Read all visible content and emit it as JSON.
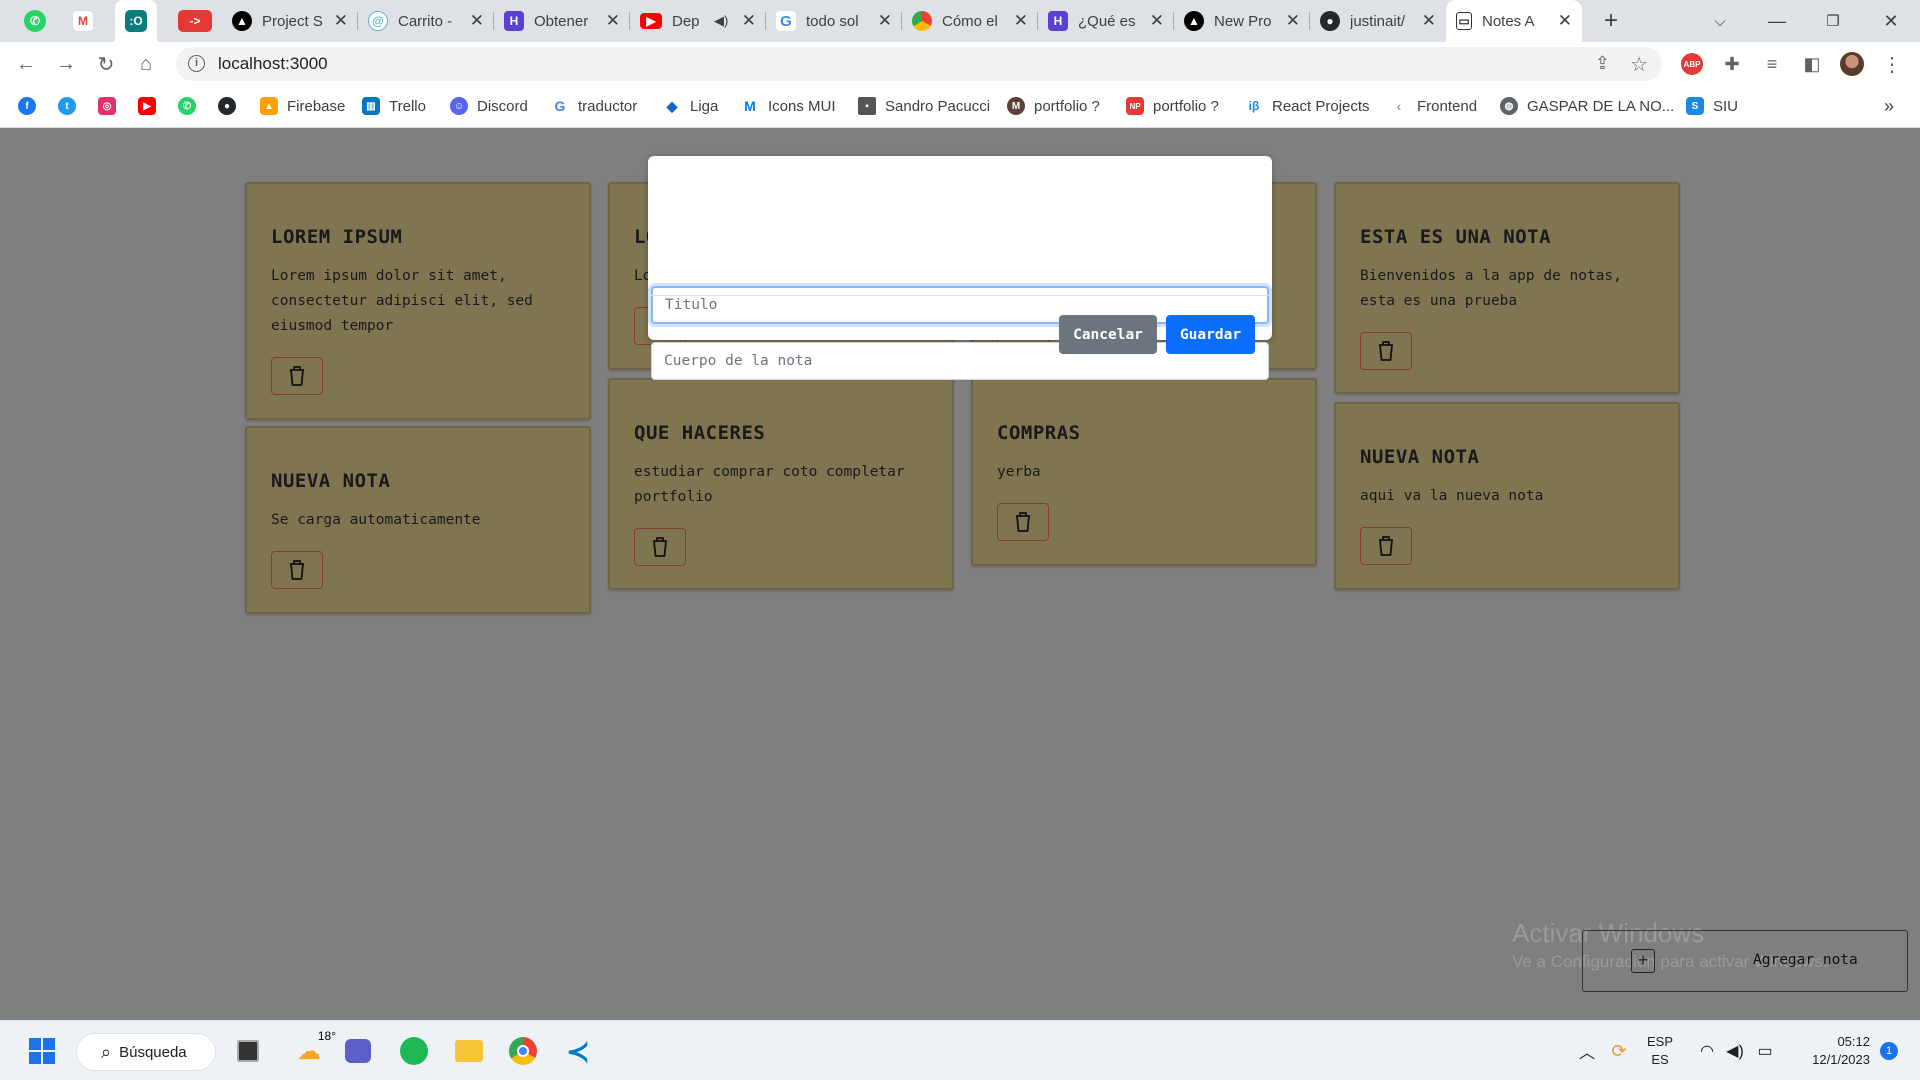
{
  "browser": {
    "pinned_tabs": [
      {
        "icon": "whatsapp-icon",
        "color": "#25d366",
        "glyph": "✆"
      },
      {
        "icon": "gmail-icon",
        "color": "#ea4335",
        "glyph": "M"
      },
      {
        "icon": "app-icon",
        "color": "#0c7c7c",
        "glyph": ":O"
      },
      {
        "icon": "redirect-icon",
        "color": "#e53935",
        "glyph": "->"
      }
    ],
    "tabs": [
      {
        "label": "Project S",
        "icon": "vercel-icon",
        "color": "#000000"
      },
      {
        "label": "Carrito -",
        "icon": "swirl-icon",
        "color": "#5fb3d3"
      },
      {
        "label": "Obtener",
        "icon": "hashnode-icon",
        "color": "#5b3fd1"
      },
      {
        "label": "Dep",
        "icon": "youtube-icon",
        "color": "#ff0000"
      },
      {
        "label": "todo sol",
        "icon": "google-icon",
        "color": "#4285f4"
      },
      {
        "label": "Cómo el",
        "icon": "chrome-icon",
        "color": "#e94235"
      },
      {
        "label": "¿Qué es",
        "icon": "hashnode-icon",
        "color": "#5b3fd1"
      },
      {
        "label": "New Pro",
        "icon": "vercel-icon",
        "color": "#000000"
      },
      {
        "label": "justinait/",
        "icon": "github-icon",
        "color": "#24292e"
      },
      {
        "label": "Notes A",
        "icon": "notes-icon",
        "color": "#333333",
        "active": true
      }
    ],
    "new_tab_glyph": "+",
    "url": "localhost:3000",
    "bookmarks": [
      {
        "label": "",
        "icon": "facebook-icon",
        "color": "#1877f2",
        "glyph": "f"
      },
      {
        "label": "",
        "icon": "twitter-icon",
        "color": "#1d9bf0",
        "glyph": "t"
      },
      {
        "label": "",
        "icon": "instagram-icon",
        "color": "#e1306c",
        "glyph": "◎"
      },
      {
        "label": "",
        "icon": "youtube-icon",
        "color": "#ff0000",
        "glyph": "▶"
      },
      {
        "label": "",
        "icon": "whatsapp-icon",
        "color": "#25d366",
        "glyph": "✆"
      },
      {
        "label": "",
        "icon": "github-icon",
        "color": "#24292e",
        "glyph": "●"
      },
      {
        "label": "Firebase",
        "icon": "firebase-icon",
        "color": "#ffa000",
        "glyph": "▲"
      },
      {
        "label": "Trello",
        "icon": "trello-icon",
        "color": "#0079bf",
        "glyph": "▥"
      },
      {
        "label": "Discord",
        "icon": "discord-icon",
        "color": "#5865f2",
        "glyph": "☺"
      },
      {
        "label": "traductor",
        "icon": "google-icon",
        "color": "#4285f4",
        "glyph": "G"
      },
      {
        "label": "Liga",
        "icon": "liga-icon",
        "color": "#1565c0",
        "glyph": "◆"
      },
      {
        "label": "Icons MUI",
        "icon": "mui-icon",
        "color": "#007fff",
        "glyph": "M"
      },
      {
        "label": "Sandro Pacucci",
        "icon": "photo-icon",
        "color": "#555555",
        "glyph": "▪"
      },
      {
        "label": "portfolio ?",
        "icon": "medium-icon",
        "color": "#5d4037",
        "glyph": "M"
      },
      {
        "label": "portfolio ?",
        "icon": "np-icon",
        "color": "#e53935",
        "glyph": "NP"
      },
      {
        "label": "React Projects",
        "icon": "react-icon",
        "color": "#61dafb",
        "glyph": "iβ"
      },
      {
        "label": "Frontend",
        "icon": "frontend-icon",
        "color": "#9e9e9e",
        "glyph": "‹"
      },
      {
        "label": "GASPAR DE LA NO...",
        "icon": "globe-icon",
        "color": "#5f6368",
        "glyph": "◍"
      },
      {
        "label": "SIU",
        "icon": "siu-icon",
        "color": "#1e88e5",
        "glyph": "S"
      }
    ],
    "more_bookmarks_glyph": "»"
  },
  "notes": [
    {
      "title": "LOREM IPSUM",
      "body": "Lorem ipsum dolor sit amet, consectetur adipisci elit, sed eiusmod tempor"
    },
    {
      "title": "NUEVA NOTA",
      "body": "Se carga automaticamente"
    },
    {
      "title": "LO",
      "body": "Lo"
    },
    {
      "title": "QUE HACERES",
      "body": "estudiar comprar coto completar portfolio"
    },
    {
      "title": "COMPRAS",
      "body": "yerba"
    },
    {
      "title": "ESTA ES UNA NOTA",
      "body": "Bienvenidos a la app de notas, esta es una prueba"
    },
    {
      "title": "NUEVA NOTA",
      "body": "aqui va la nueva nota"
    }
  ],
  "modal": {
    "title_placeholder": "Titulo",
    "body_placeholder": "Cuerpo de la nota",
    "cancel_label": "Cancelar",
    "save_label": "Guardar",
    "cancel_color": "#6c757d",
    "save_color": "#0d6efd"
  },
  "add_note_label": "Agregar nota",
  "add_note_glyph": "+",
  "watermark": {
    "line1": "Activar Windows",
    "line2": "Ve a Configuración para activar Windows."
  },
  "taskbar": {
    "search_label": "Búsqueda",
    "weather_temp": "18°",
    "lang_top": "ESP",
    "lang_bottom": "ES",
    "time": "05:12",
    "date": "12/1/2023",
    "notifications": "1"
  }
}
